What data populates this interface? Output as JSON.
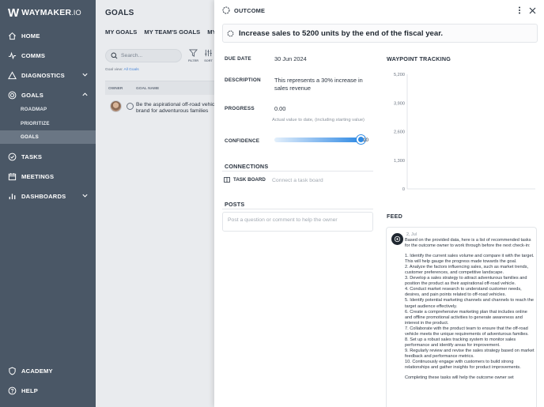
{
  "sidebar": {
    "logo_mark": "W",
    "logo_name": "WAYMAKER",
    "logo_tld": ".IO",
    "items": [
      {
        "label": "HOME",
        "icon": "home-icon"
      },
      {
        "label": "COMMS",
        "icon": "pulse-icon"
      },
      {
        "label": "DIAGNOSTICS",
        "icon": "warning-icon"
      },
      {
        "label": "GOALS",
        "icon": "target-icon"
      },
      {
        "label": "TASKS",
        "icon": "check-circle-icon"
      },
      {
        "label": "MEETINGS",
        "icon": "calendar-icon"
      },
      {
        "label": "DASHBOARDS",
        "icon": "bar-chart-icon"
      },
      {
        "label": "ACADEMY",
        "icon": "shield-icon"
      },
      {
        "label": "HELP",
        "icon": "help-icon"
      }
    ],
    "goals_sub": [
      {
        "label": "ROADMAP"
      },
      {
        "label": "PRIORITIZE"
      },
      {
        "label": "GOALS"
      }
    ]
  },
  "goals_page": {
    "title": "GOALS",
    "tabs": [
      "MY GOALS",
      "MY TEAM'S GOALS",
      "MY CO"
    ],
    "search_placeholder": "Search...",
    "filter_label": "FILTER",
    "sort_label": "SORT",
    "goal_view_label": "Goal view:",
    "goal_view_value": "All Goals",
    "col_owner": "OWNER",
    "col_goal_name": "GOAL NAME",
    "row_goal": "Be the aspirational off-road vehicle brand for adventurous families"
  },
  "panel": {
    "type_label": "OUTCOME",
    "title": "Increase sales to 5200 units by the end of the fiscal year.",
    "due_date_label": "DUE DATE",
    "due_date": "30 Jun 2024",
    "description_label": "DESCRIPTION",
    "description": "This represents a 30% increase in sales revenue",
    "progress_label": "PROGRESS",
    "progress": "0.00",
    "progress_hint": "Actual value to date, (including starting value)",
    "confidence_label": "CONFIDENCE",
    "confidence": "10",
    "confidence_fraction": 1.0,
    "connections_label": "CONNECTIONS",
    "task_board_label": "TASK BOARD",
    "connect_placeholder": "Connect a task board",
    "posts_label": "POSTS",
    "post_placeholder": "Post a question or comment to help the owner",
    "waypoint_label": "WAYPOINT TRACKING",
    "feed_label": "FEED"
  },
  "chart_data": {
    "type": "line",
    "title": "",
    "xlabel": "",
    "ylabel": "",
    "yticks": [
      "5,200",
      "3,900",
      "2,600",
      "1,300",
      "0"
    ],
    "ylim": [
      0,
      5200
    ],
    "series": [],
    "grid": false
  },
  "feed": {
    "date": "2, Jul",
    "intro": "Based on the provided data, here is a list of recommended tasks for the outcome owner to work through before the next check-in:",
    "items": [
      "1. Identify the current sales volume and compare it with the target. This will help gauge the progress made towards the goal.",
      "2. Analyze the factors influencing sales, such as market trends, customer preferences, and competitive landscape.",
      "3. Develop a sales strategy to attract adventurous families and position the product as their aspirational off-road vehicle.",
      "4. Conduct market research to understand customer needs, desires, and pain points related to off-road vehicles.",
      "5. Identify potential marketing channels and channels to reach the target audience effectively.",
      "6. Create a comprehensive marketing plan that includes online and offline promotional activities to generate awareness and interest in the product.",
      "7. Collaborate with the product team to ensure that the off-road vehicle meets the unique requirements of adventurous families.",
      "8. Set up a robust sales tracking system to monitor sales performance and identify areas for improvement.",
      "9. Regularly review and revise the sales strategy based on market feedback and performance metrics.",
      "10. Continuously engage with customers to build strong relationships and gather insights for product improvements."
    ],
    "outro": "Completing these tasks will help the outcome owner set"
  },
  "colors": {
    "sidebar_bg": "#4a5766",
    "sidebar_active": "#6a7684",
    "accent": "#2f8ae3"
  }
}
